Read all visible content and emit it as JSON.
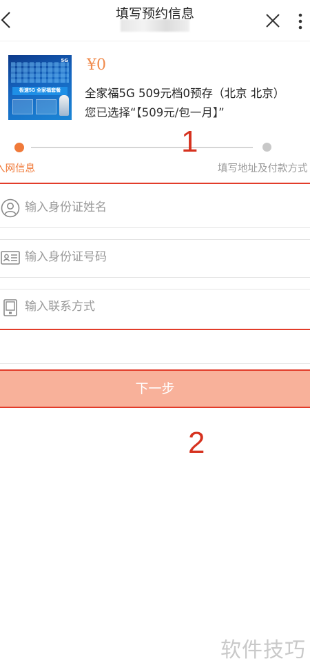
{
  "header": {
    "title": "填写预约信息",
    "subtitle": "",
    "back_icon": "chevron-left-icon",
    "close_icon": "close-icon",
    "more_icon": "more-vertical-icon"
  },
  "product": {
    "price": "¥0",
    "name": "全家福5G 509元档0预存（北京 北京）",
    "selection": "您已选择“【509元/包一月】”",
    "thumbnail": {
      "title": "极速5G 全家福套餐",
      "tag": "5G"
    }
  },
  "steps": {
    "step1_label": "入网信息",
    "step2_label": "填写地址及付款方式",
    "active_color": "#f07a3a",
    "inactive_color": "#c8c8c8"
  },
  "annotations": {
    "marker1": "1",
    "marker2": "2",
    "color": "#d6321f"
  },
  "form": {
    "name_placeholder": "输入身份证姓名",
    "id_placeholder": "输入身份证号码",
    "phone_placeholder": "输入联系方式",
    "name_icon": "user-icon",
    "id_icon": "id-card-icon",
    "phone_icon": "phone-icon"
  },
  "next_button": {
    "label": "下一步",
    "color": "#f8b19a"
  },
  "watermark": "软件技巧"
}
